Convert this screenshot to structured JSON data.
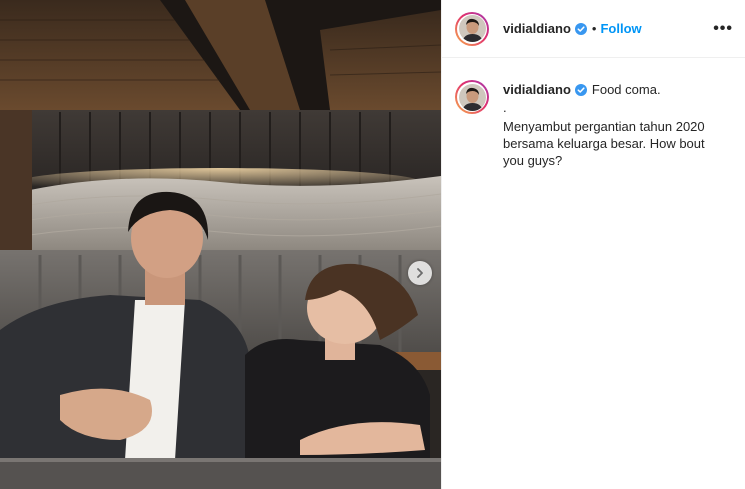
{
  "post": {
    "username": "vidialdiano",
    "follow_label": "Follow",
    "separator": "•",
    "more_label": "•••"
  },
  "caption": {
    "username": "vidialdiano",
    "title": "Food coma.",
    "dot_line": ".",
    "text": "Menyambut pergantian tahun 2020 bersama keluarga besar. How bout you guys?"
  },
  "colors": {
    "accent": "#0095f6",
    "text": "#262626",
    "verified": "#3897f0"
  },
  "icons": {
    "verified": "verified-badge-icon",
    "next": "chevron-right-icon",
    "more": "more-options-icon"
  }
}
